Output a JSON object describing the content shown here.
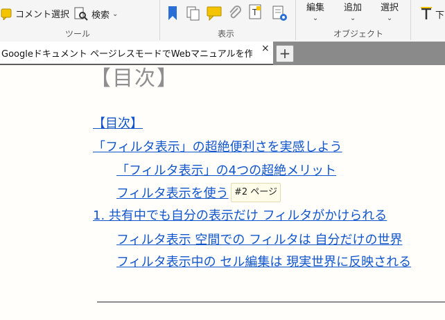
{
  "ribbon": {
    "comment_select_label": "コメント選択",
    "search_label": "検索",
    "tools_group_label": "ツール",
    "display_group_label": "表示",
    "objects_group_label": "オブジェクト",
    "edit_label": "編集",
    "add_label": "追加",
    "select_label": "選択",
    "partial_label": "下"
  },
  "tabs": [
    {
      "title": "Googleドキュメント ページレスモードでWebマニュアルを作ろう ..",
      "close": "×"
    }
  ],
  "new_tab_symbol": "+",
  "document": {
    "heading": "【目次】",
    "toc": [
      {
        "text": "【目次】",
        "level": 0
      },
      {
        "text": "「フィルタ表示」の超絶便利さを実感しよう",
        "level": 0
      },
      {
        "text": "「フィルタ表示」の4つの超絶メリット",
        "level": 1
      },
      {
        "text": "フィルタ表示を使う",
        "level": 1
      },
      {
        "text": "1. 共有中でも自分の表示だけ フィルタがかけられる",
        "level": 0
      },
      {
        "text": "フィルタ表示 空間での フィルタは 自分だけの世界",
        "level": 1
      },
      {
        "text": "フィルタ表示中の セル編集は 現実世界に反映される",
        "level": 1
      }
    ],
    "tooltip": "#2 ページ"
  },
  "colors": {
    "link": "#1155cc",
    "heading": "#8f8f8f",
    "tab_bar": "#8a8a8a",
    "bookmark_blue": "#2a6fd6",
    "comment_yellow": "#f5c400"
  }
}
